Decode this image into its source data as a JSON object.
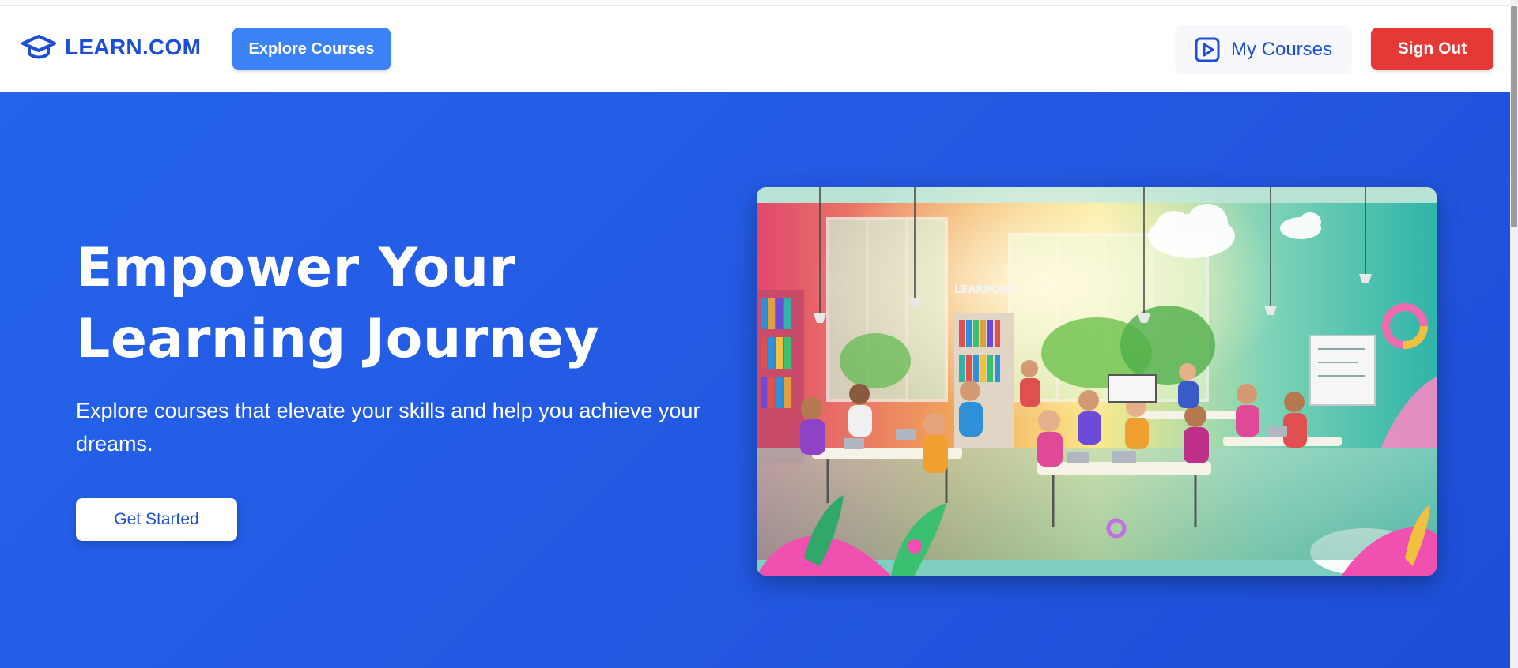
{
  "brand": {
    "name": "LEARN.COM",
    "icon": "graduation-cap-icon"
  },
  "nav": {
    "explore_label": "Explore Courses",
    "my_courses_label": "My Courses",
    "my_courses_icon": "play-square-icon",
    "sign_out_label": "Sign Out"
  },
  "hero": {
    "title_line1": "Empower Your",
    "title_line2": "Learning Journey",
    "subtitle": "Explore courses that elevate your skills and help you achieve your dreams.",
    "cta_label": "Get Started",
    "image_sign": "LEARPONG"
  },
  "colors": {
    "brand": "#1d4ed8",
    "hero_bg": "#2563eb",
    "explore_button": "#3b82f6",
    "sign_out_button": "#e53935"
  }
}
